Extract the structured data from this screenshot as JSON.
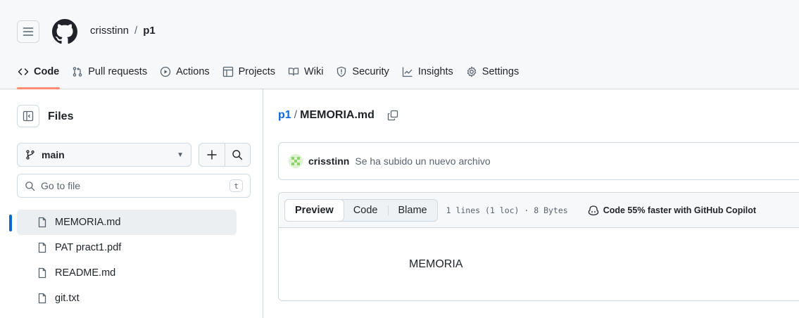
{
  "header": {
    "owner": "crisstinn",
    "separator": "/",
    "repo": "p1"
  },
  "tabs": [
    {
      "label": "Code",
      "icon": "code-icon",
      "active": true
    },
    {
      "label": "Pull requests",
      "icon": "git-pull-request-icon"
    },
    {
      "label": "Actions",
      "icon": "play-icon"
    },
    {
      "label": "Projects",
      "icon": "table-icon"
    },
    {
      "label": "Wiki",
      "icon": "book-icon"
    },
    {
      "label": "Security",
      "icon": "shield-icon"
    },
    {
      "label": "Insights",
      "icon": "graph-icon"
    },
    {
      "label": "Settings",
      "icon": "gear-icon"
    }
  ],
  "sidebar": {
    "title": "Files",
    "branch": "main",
    "goto_placeholder": "Go to file",
    "goto_shortcut": "t",
    "files": [
      {
        "name": "MEMORIA.md",
        "selected": true
      },
      {
        "name": "PAT pract1.pdf"
      },
      {
        "name": "README.md"
      },
      {
        "name": "git.txt"
      }
    ]
  },
  "breadcrumb": {
    "root": "p1",
    "separator": "/",
    "file": "MEMORIA.md"
  },
  "commit": {
    "author": "crisstinn",
    "message": "Se ha subido un nuevo archivo"
  },
  "file_view": {
    "modes": [
      "Preview",
      "Code",
      "Blame"
    ],
    "active_mode": "Preview",
    "meta": "1 lines (1 loc) · 8 Bytes",
    "copilot": "Code 55% faster with GitHub Copilot",
    "content": "MEMORIA"
  },
  "colors": {
    "accent": "#0969da",
    "active_tab_underline": "#fd8c73",
    "border": "#d1d9e0",
    "header_bg": "#f6f8fa"
  }
}
